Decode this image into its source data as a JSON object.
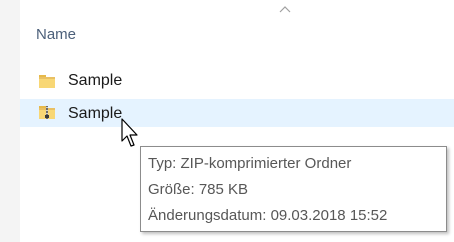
{
  "list": {
    "column_header": "Name",
    "sort_direction_icon": "chevron-up-icon",
    "items": [
      {
        "label": "Sample",
        "icon": "folder-icon",
        "selected": false
      },
      {
        "label": "Sample",
        "icon": "zip-folder-icon",
        "selected": true
      }
    ]
  },
  "tooltip": {
    "type_line": "Typ: ZIP-komprimierter Ordner",
    "size_line": "Größe: 785 KB",
    "date_line": "Änderungsdatum: 09.03.2018 15:52"
  },
  "colors": {
    "hover_row": "#e5f3ff",
    "folder_yellow": "#f8d775",
    "header_text": "#4c607a"
  }
}
